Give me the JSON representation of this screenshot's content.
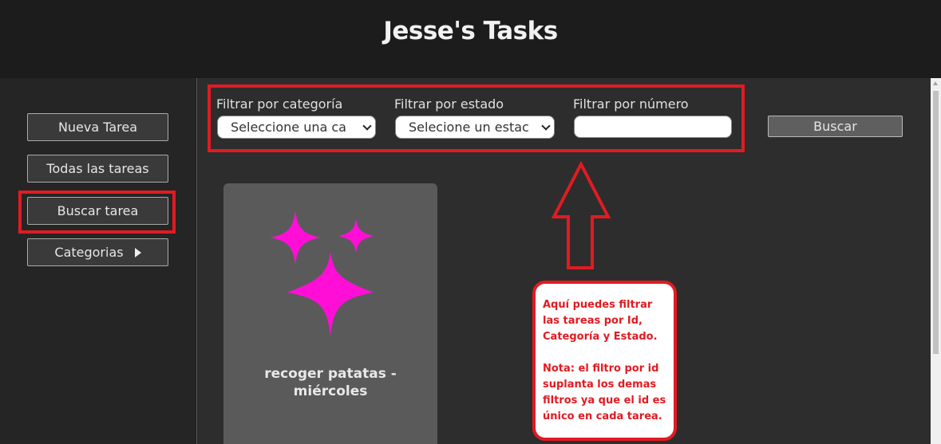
{
  "app": {
    "title": "Jesse's Tasks"
  },
  "sidebar": {
    "items": [
      {
        "label": "Nueva Tarea"
      },
      {
        "label": "Todas las tareas"
      },
      {
        "label": "Buscar tarea"
      },
      {
        "label": "Categorias"
      }
    ]
  },
  "filters": {
    "category": {
      "label": "Filtrar por categoría",
      "selected": "Seleccione una ca"
    },
    "status": {
      "label": "Filtrar por estado",
      "selected": "Selecione un estac"
    },
    "number": {
      "label": "Filtrar por número",
      "value": ""
    },
    "search_label": "Buscar"
  },
  "task_card": {
    "title_line1": "recoger patatas -",
    "title_line2": "miércoles",
    "icon": "sparkles-icon",
    "icon_color": "#ff0fd6"
  },
  "annotation": {
    "color": "#e11b22",
    "text1": "Aquí puedes filtrar las tareas por Id, Categoría y Estado.",
    "text2": "Nota: el filtro por id suplanta los demas filtros ya que el id es único en cada tarea."
  }
}
